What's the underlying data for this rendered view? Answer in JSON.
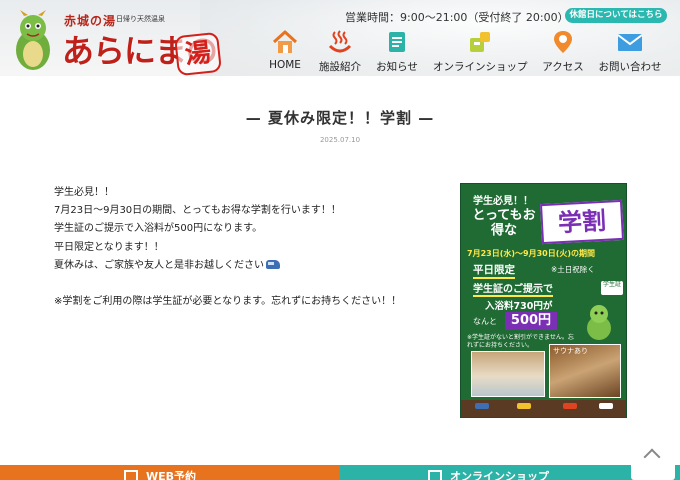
{
  "header": {
    "logo_small": "赤城の湯",
    "logo_sub": "日帰り天然温泉",
    "logo_main": "あらにまの",
    "logo_yu": "湯",
    "hours": "営業時間：9:00〜21:00（受付終了 20:00）",
    "closed_button": "休館日についてはこちら"
  },
  "nav": [
    {
      "label": "HOME",
      "icon": "house-icon"
    },
    {
      "label": "施設紹介",
      "icon": "onsen-icon"
    },
    {
      "label": "お知らせ",
      "icon": "notice-icon"
    },
    {
      "label": "オンラインショップ",
      "icon": "shop-icon"
    },
    {
      "label": "アクセス",
      "icon": "map-pin-icon"
    },
    {
      "label": "お問い合わせ",
      "icon": "mail-icon"
    }
  ],
  "article": {
    "title": "— 夏休み限定！！学割 —",
    "date": "2025.07.10",
    "paragraphs": [
      "学生必見！！",
      "7月23日〜9月30日の期間、とってもお得な学割を行います！！",
      "学生証のご提示で入浴料が500円になります。",
      "平日限定となります！！",
      "夏休みは、ご家族や友人と是非お越しください",
      "※学割をご利用の際は学生証が必要となります。忘れずにお持ちください！！"
    ]
  },
  "flyer": {
    "line1": "学生必見！！",
    "line2": "とってもお得な",
    "badge": "学割",
    "period": "7月23日(水)〜9月30日(火)の期間",
    "weekday": "平日限定",
    "weekday_note": "※土日祝除く",
    "student": "学生証のご提示で",
    "student_tag": "学生証",
    "fee": "入浴料730円が",
    "nanto": "なんと",
    "price": "500円",
    "note": "※学生証がないと割引ができません。忘れずにお持ちください。",
    "photo_label": "サウナあり"
  },
  "bottom": {
    "left_label": "WEB予約",
    "right_label": "オンラインショップ"
  },
  "colors": {
    "accent_teal": "#2bb3a8",
    "accent_orange": "#e8731f",
    "logo_red": "#c0201a",
    "flyer_green": "#1f6b33",
    "flyer_purple": "#7a2fb5"
  }
}
